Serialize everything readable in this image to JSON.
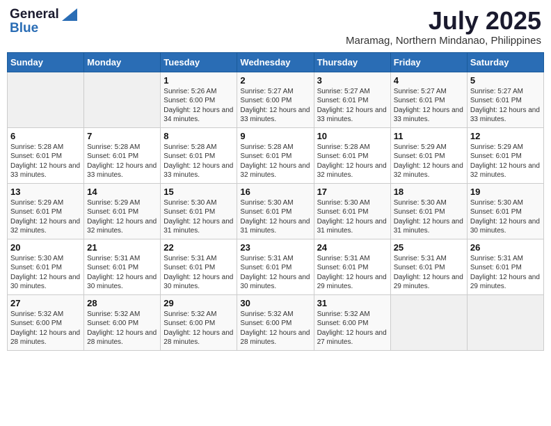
{
  "header": {
    "logo_line1": "General",
    "logo_line2": "Blue",
    "month_year": "July 2025",
    "location": "Maramag, Northern Mindanao, Philippines"
  },
  "days_of_week": [
    "Sunday",
    "Monday",
    "Tuesday",
    "Wednesday",
    "Thursday",
    "Friday",
    "Saturday"
  ],
  "weeks": [
    [
      {
        "day": "",
        "empty": true
      },
      {
        "day": "",
        "empty": true
      },
      {
        "day": "1",
        "sunrise": "5:26 AM",
        "sunset": "6:00 PM",
        "daylight": "12 hours and 34 minutes."
      },
      {
        "day": "2",
        "sunrise": "5:27 AM",
        "sunset": "6:00 PM",
        "daylight": "12 hours and 33 minutes."
      },
      {
        "day": "3",
        "sunrise": "5:27 AM",
        "sunset": "6:01 PM",
        "daylight": "12 hours and 33 minutes."
      },
      {
        "day": "4",
        "sunrise": "5:27 AM",
        "sunset": "6:01 PM",
        "daylight": "12 hours and 33 minutes."
      },
      {
        "day": "5",
        "sunrise": "5:27 AM",
        "sunset": "6:01 PM",
        "daylight": "12 hours and 33 minutes."
      }
    ],
    [
      {
        "day": "6",
        "sunrise": "5:28 AM",
        "sunset": "6:01 PM",
        "daylight": "12 hours and 33 minutes."
      },
      {
        "day": "7",
        "sunrise": "5:28 AM",
        "sunset": "6:01 PM",
        "daylight": "12 hours and 33 minutes."
      },
      {
        "day": "8",
        "sunrise": "5:28 AM",
        "sunset": "6:01 PM",
        "daylight": "12 hours and 33 minutes."
      },
      {
        "day": "9",
        "sunrise": "5:28 AM",
        "sunset": "6:01 PM",
        "daylight": "12 hours and 32 minutes."
      },
      {
        "day": "10",
        "sunrise": "5:28 AM",
        "sunset": "6:01 PM",
        "daylight": "12 hours and 32 minutes."
      },
      {
        "day": "11",
        "sunrise": "5:29 AM",
        "sunset": "6:01 PM",
        "daylight": "12 hours and 32 minutes."
      },
      {
        "day": "12",
        "sunrise": "5:29 AM",
        "sunset": "6:01 PM",
        "daylight": "12 hours and 32 minutes."
      }
    ],
    [
      {
        "day": "13",
        "sunrise": "5:29 AM",
        "sunset": "6:01 PM",
        "daylight": "12 hours and 32 minutes."
      },
      {
        "day": "14",
        "sunrise": "5:29 AM",
        "sunset": "6:01 PM",
        "daylight": "12 hours and 32 minutes."
      },
      {
        "day": "15",
        "sunrise": "5:30 AM",
        "sunset": "6:01 PM",
        "daylight": "12 hours and 31 minutes."
      },
      {
        "day": "16",
        "sunrise": "5:30 AM",
        "sunset": "6:01 PM",
        "daylight": "12 hours and 31 minutes."
      },
      {
        "day": "17",
        "sunrise": "5:30 AM",
        "sunset": "6:01 PM",
        "daylight": "12 hours and 31 minutes."
      },
      {
        "day": "18",
        "sunrise": "5:30 AM",
        "sunset": "6:01 PM",
        "daylight": "12 hours and 31 minutes."
      },
      {
        "day": "19",
        "sunrise": "5:30 AM",
        "sunset": "6:01 PM",
        "daylight": "12 hours and 30 minutes."
      }
    ],
    [
      {
        "day": "20",
        "sunrise": "5:30 AM",
        "sunset": "6:01 PM",
        "daylight": "12 hours and 30 minutes."
      },
      {
        "day": "21",
        "sunrise": "5:31 AM",
        "sunset": "6:01 PM",
        "daylight": "12 hours and 30 minutes."
      },
      {
        "day": "22",
        "sunrise": "5:31 AM",
        "sunset": "6:01 PM",
        "daylight": "12 hours and 30 minutes."
      },
      {
        "day": "23",
        "sunrise": "5:31 AM",
        "sunset": "6:01 PM",
        "daylight": "12 hours and 30 minutes."
      },
      {
        "day": "24",
        "sunrise": "5:31 AM",
        "sunset": "6:01 PM",
        "daylight": "12 hours and 29 minutes."
      },
      {
        "day": "25",
        "sunrise": "5:31 AM",
        "sunset": "6:01 PM",
        "daylight": "12 hours and 29 minutes."
      },
      {
        "day": "26",
        "sunrise": "5:31 AM",
        "sunset": "6:01 PM",
        "daylight": "12 hours and 29 minutes."
      }
    ],
    [
      {
        "day": "27",
        "sunrise": "5:32 AM",
        "sunset": "6:00 PM",
        "daylight": "12 hours and 28 minutes."
      },
      {
        "day": "28",
        "sunrise": "5:32 AM",
        "sunset": "6:00 PM",
        "daylight": "12 hours and 28 minutes."
      },
      {
        "day": "29",
        "sunrise": "5:32 AM",
        "sunset": "6:00 PM",
        "daylight": "12 hours and 28 minutes."
      },
      {
        "day": "30",
        "sunrise": "5:32 AM",
        "sunset": "6:00 PM",
        "daylight": "12 hours and 28 minutes."
      },
      {
        "day": "31",
        "sunrise": "5:32 AM",
        "sunset": "6:00 PM",
        "daylight": "12 hours and 27 minutes."
      },
      {
        "day": "",
        "empty": true
      },
      {
        "day": "",
        "empty": true
      }
    ]
  ]
}
